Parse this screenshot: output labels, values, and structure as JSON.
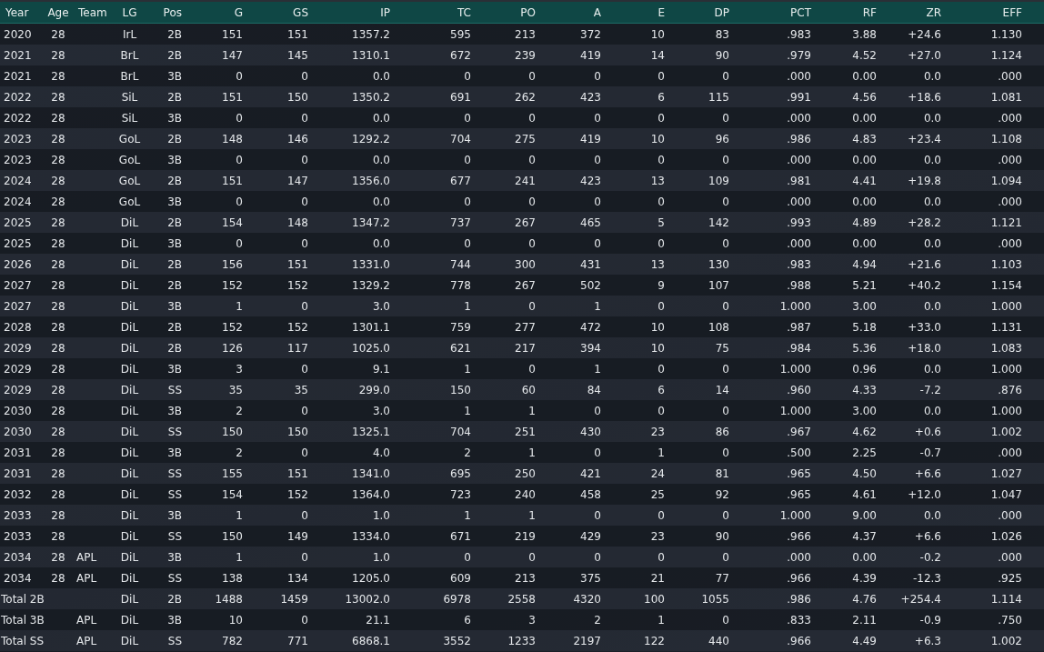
{
  "table": {
    "columns": [
      "Year",
      "Age",
      "Team",
      "LG",
      "Pos",
      "G",
      "GS",
      "IP",
      "TC",
      "PO",
      "A",
      "E",
      "DP",
      "PCT",
      "RF",
      "ZR",
      "EFF"
    ],
    "rows": [
      {
        "year": "2020",
        "age": "28",
        "lg": "IrL",
        "pos": "2B",
        "g": "151",
        "gs": "151",
        "ip": "1357.2",
        "tc": "595",
        "po": "213",
        "a": "372",
        "e": "10",
        "dp": "83",
        "pct": ".983",
        "rf": "3.88",
        "zr": "+24.6",
        "eff": "1.130"
      },
      {
        "year": "2021",
        "age": "28",
        "lg": "BrL",
        "pos": "2B",
        "g": "147",
        "gs": "145",
        "ip": "1310.1",
        "tc": "672",
        "po": "239",
        "a": "419",
        "e": "14",
        "dp": "90",
        "pct": ".979",
        "rf": "4.52",
        "zr": "+27.0",
        "eff": "1.124"
      },
      {
        "year": "2021",
        "age": "28",
        "lg": "BrL",
        "pos": "3B",
        "g": "0",
        "gs": "0",
        "ip": "0.0",
        "tc": "0",
        "po": "0",
        "a": "0",
        "e": "0",
        "dp": "0",
        "pct": ".000",
        "rf": "0.00",
        "zr": "0.0",
        "eff": ".000"
      },
      {
        "year": "2022",
        "age": "28",
        "lg": "SiL",
        "pos": "2B",
        "g": "151",
        "gs": "150",
        "ip": "1350.2",
        "tc": "691",
        "po": "262",
        "a": "423",
        "e": "6",
        "dp": "115",
        "pct": ".991",
        "rf": "4.56",
        "zr": "+18.6",
        "eff": "1.081"
      },
      {
        "year": "2022",
        "age": "28",
        "lg": "SiL",
        "pos": "3B",
        "g": "0",
        "gs": "0",
        "ip": "0.0",
        "tc": "0",
        "po": "0",
        "a": "0",
        "e": "0",
        "dp": "0",
        "pct": ".000",
        "rf": "0.00",
        "zr": "0.0",
        "eff": ".000"
      },
      {
        "year": "2023",
        "age": "28",
        "lg": "GoL",
        "pos": "2B",
        "g": "148",
        "gs": "146",
        "ip": "1292.2",
        "tc": "704",
        "po": "275",
        "a": "419",
        "e": "10",
        "dp": "96",
        "pct": ".986",
        "rf": "4.83",
        "zr": "+23.4",
        "eff": "1.108"
      },
      {
        "year": "2023",
        "age": "28",
        "lg": "GoL",
        "pos": "3B",
        "g": "0",
        "gs": "0",
        "ip": "0.0",
        "tc": "0",
        "po": "0",
        "a": "0",
        "e": "0",
        "dp": "0",
        "pct": ".000",
        "rf": "0.00",
        "zr": "0.0",
        "eff": ".000"
      },
      {
        "year": "2024",
        "age": "28",
        "lg": "GoL",
        "pos": "2B",
        "g": "151",
        "gs": "147",
        "ip": "1356.0",
        "tc": "677",
        "po": "241",
        "a": "423",
        "e": "13",
        "dp": "109",
        "pct": ".981",
        "rf": "4.41",
        "zr": "+19.8",
        "eff": "1.094"
      },
      {
        "year": "2024",
        "age": "28",
        "lg": "GoL",
        "pos": "3B",
        "g": "0",
        "gs": "0",
        "ip": "0.0",
        "tc": "0",
        "po": "0",
        "a": "0",
        "e": "0",
        "dp": "0",
        "pct": ".000",
        "rf": "0.00",
        "zr": "0.0",
        "eff": ".000"
      },
      {
        "year": "2025",
        "age": "28",
        "lg": "DiL",
        "pos": "2B",
        "g": "154",
        "gs": "148",
        "ip": "1347.2",
        "tc": "737",
        "po": "267",
        "a": "465",
        "e": "5",
        "dp": "142",
        "pct": ".993",
        "rf": "4.89",
        "zr": "+28.2",
        "eff": "1.121"
      },
      {
        "year": "2025",
        "age": "28",
        "lg": "DiL",
        "pos": "3B",
        "g": "0",
        "gs": "0",
        "ip": "0.0",
        "tc": "0",
        "po": "0",
        "a": "0",
        "e": "0",
        "dp": "0",
        "pct": ".000",
        "rf": "0.00",
        "zr": "0.0",
        "eff": ".000"
      },
      {
        "year": "2026",
        "age": "28",
        "lg": "DiL",
        "pos": "2B",
        "g": "156",
        "gs": "151",
        "ip": "1331.0",
        "tc": "744",
        "po": "300",
        "a": "431",
        "e": "13",
        "dp": "130",
        "pct": ".983",
        "rf": "4.94",
        "zr": "+21.6",
        "eff": "1.103"
      },
      {
        "year": "2027",
        "age": "28",
        "lg": "DiL",
        "pos": "2B",
        "g": "152",
        "gs": "152",
        "ip": "1329.2",
        "tc": "778",
        "po": "267",
        "a": "502",
        "e": "9",
        "dp": "107",
        "pct": ".988",
        "rf": "5.21",
        "zr": "+40.2",
        "eff": "1.154"
      },
      {
        "year": "2027",
        "age": "28",
        "lg": "DiL",
        "pos": "3B",
        "g": "1",
        "gs": "0",
        "ip": "3.0",
        "tc": "1",
        "po": "0",
        "a": "1",
        "e": "0",
        "dp": "0",
        "pct": "1.000",
        "rf": "3.00",
        "zr": "0.0",
        "eff": "1.000"
      },
      {
        "year": "2028",
        "age": "28",
        "lg": "DiL",
        "pos": "2B",
        "g": "152",
        "gs": "152",
        "ip": "1301.1",
        "tc": "759",
        "po": "277",
        "a": "472",
        "e": "10",
        "dp": "108",
        "pct": ".987",
        "rf": "5.18",
        "zr": "+33.0",
        "eff": "1.131"
      },
      {
        "year": "2029",
        "age": "28",
        "lg": "DiL",
        "pos": "2B",
        "g": "126",
        "gs": "117",
        "ip": "1025.0",
        "tc": "621",
        "po": "217",
        "a": "394",
        "e": "10",
        "dp": "75",
        "pct": ".984",
        "rf": "5.36",
        "zr": "+18.0",
        "eff": "1.083"
      },
      {
        "year": "2029",
        "age": "28",
        "lg": "DiL",
        "pos": "3B",
        "g": "3",
        "gs": "0",
        "ip": "9.1",
        "tc": "1",
        "po": "0",
        "a": "1",
        "e": "0",
        "dp": "0",
        "pct": "1.000",
        "rf": "0.96",
        "zr": "0.0",
        "eff": "1.000"
      },
      {
        "year": "2029",
        "age": "28",
        "lg": "DiL",
        "pos": "SS",
        "g": "35",
        "gs": "35",
        "ip": "299.0",
        "tc": "150",
        "po": "60",
        "a": "84",
        "e": "6",
        "dp": "14",
        "pct": ".960",
        "rf": "4.33",
        "zr": "-7.2",
        "eff": ".876"
      },
      {
        "year": "2030",
        "age": "28",
        "lg": "DiL",
        "pos": "3B",
        "g": "2",
        "gs": "0",
        "ip": "3.0",
        "tc": "1",
        "po": "1",
        "a": "0",
        "e": "0",
        "dp": "0",
        "pct": "1.000",
        "rf": "3.00",
        "zr": "0.0",
        "eff": "1.000"
      },
      {
        "year": "2030",
        "age": "28",
        "lg": "DiL",
        "pos": "SS",
        "g": "150",
        "gs": "150",
        "ip": "1325.1",
        "tc": "704",
        "po": "251",
        "a": "430",
        "e": "23",
        "dp": "86",
        "pct": ".967",
        "rf": "4.62",
        "zr": "+0.6",
        "eff": "1.002"
      },
      {
        "year": "2031",
        "age": "28",
        "lg": "DiL",
        "pos": "3B",
        "g": "2",
        "gs": "0",
        "ip": "4.0",
        "tc": "2",
        "po": "1",
        "a": "0",
        "e": "1",
        "dp": "0",
        "pct": ".500",
        "rf": "2.25",
        "zr": "-0.7",
        "eff": ".000"
      },
      {
        "year": "2031",
        "age": "28",
        "lg": "DiL",
        "pos": "SS",
        "g": "155",
        "gs": "151",
        "ip": "1341.0",
        "tc": "695",
        "po": "250",
        "a": "421",
        "e": "24",
        "dp": "81",
        "pct": ".965",
        "rf": "4.50",
        "zr": "+6.6",
        "eff": "1.027"
      },
      {
        "year": "2032",
        "age": "28",
        "lg": "DiL",
        "pos": "SS",
        "g": "154",
        "gs": "152",
        "ip": "1364.0",
        "tc": "723",
        "po": "240",
        "a": "458",
        "e": "25",
        "dp": "92",
        "pct": ".965",
        "rf": "4.61",
        "zr": "+12.0",
        "eff": "1.047"
      },
      {
        "year": "2033",
        "age": "28",
        "lg": "DiL",
        "pos": "3B",
        "g": "1",
        "gs": "0",
        "ip": "1.0",
        "tc": "1",
        "po": "1",
        "a": "0",
        "e": "0",
        "dp": "0",
        "pct": "1.000",
        "rf": "9.00",
        "zr": "0.0",
        "eff": ".000"
      },
      {
        "year": "2033",
        "age": "28",
        "lg": "DiL",
        "pos": "SS",
        "g": "150",
        "gs": "149",
        "ip": "1334.0",
        "tc": "671",
        "po": "219",
        "a": "429",
        "e": "23",
        "dp": "90",
        "pct": ".966",
        "rf": "4.37",
        "zr": "+6.6",
        "eff": "1.026"
      },
      {
        "year": "2034",
        "age": "28",
        "team": "APL",
        "lg": "DiL",
        "pos": "3B",
        "g": "1",
        "gs": "0",
        "ip": "1.0",
        "tc": "0",
        "po": "0",
        "a": "0",
        "e": "0",
        "dp": "0",
        "pct": ".000",
        "rf": "0.00",
        "zr": "-0.2",
        "eff": ".000"
      },
      {
        "year": "2034",
        "age": "28",
        "team": "APL",
        "lg": "DiL",
        "pos": "SS",
        "g": "138",
        "gs": "134",
        "ip": "1205.0",
        "tc": "609",
        "po": "213",
        "a": "375",
        "e": "21",
        "dp": "77",
        "pct": ".966",
        "rf": "4.39",
        "zr": "-12.3",
        "eff": ".925"
      },
      {
        "year": "Total 2B",
        "lg": "DiL",
        "pos": "2B",
        "g": "1488",
        "gs": "1459",
        "ip": "13002.0",
        "tc": "6978",
        "po": "2558",
        "a": "4320",
        "e": "100",
        "dp": "1055",
        "pct": ".986",
        "rf": "4.76",
        "zr": "+254.4",
        "eff": "1.114"
      },
      {
        "year": "Total 3B",
        "team": "APL",
        "lg": "DiL",
        "pos": "3B",
        "g": "10",
        "gs": "0",
        "ip": "21.1",
        "tc": "6",
        "po": "3",
        "a": "2",
        "e": "1",
        "dp": "0",
        "pct": ".833",
        "rf": "2.11",
        "zr": "-0.9",
        "eff": ".750"
      },
      {
        "year": "Total SS",
        "team": "APL",
        "lg": "DiL",
        "pos": "SS",
        "g": "782",
        "gs": "771",
        "ip": "6868.1",
        "tc": "3552",
        "po": "1233",
        "a": "2197",
        "e": "122",
        "dp": "440",
        "pct": ".966",
        "rf": "4.49",
        "zr": "+6.3",
        "eff": "1.002"
      }
    ]
  }
}
